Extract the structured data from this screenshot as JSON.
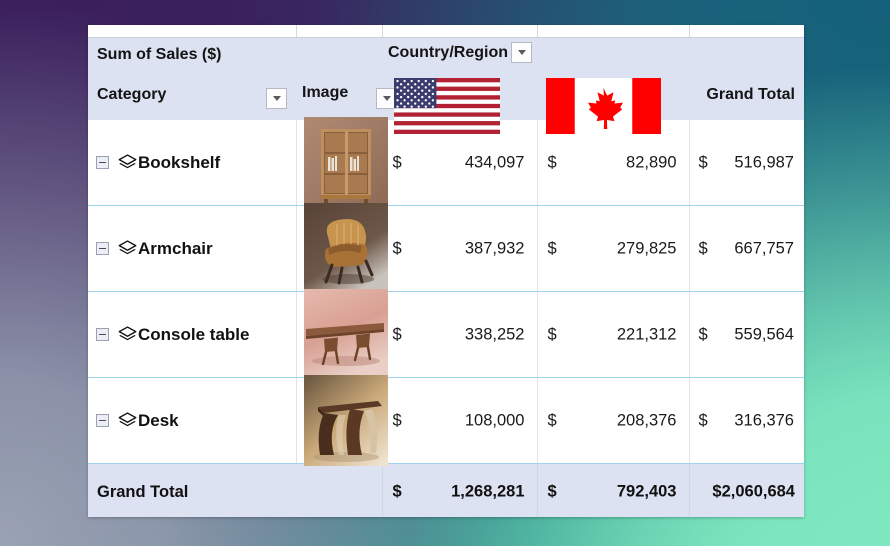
{
  "header": {
    "value_field_label": "Sum of Sales ($)",
    "column_field_label": "Country/Region",
    "row_field_label": "Category",
    "image_field_label": "Image",
    "grand_total_label": "Grand Total",
    "filters": [
      {
        "name": "category-filter",
        "label": "Category filter dropdown"
      },
      {
        "name": "image-filter",
        "label": "Image filter dropdown"
      },
      {
        "name": "country-filter",
        "label": "Country/Region filter dropdown"
      }
    ],
    "columns": [
      {
        "key": "us",
        "label": "United States",
        "icon": "flag-united-states"
      },
      {
        "key": "ca",
        "label": "Canada",
        "icon": "flag-canada"
      }
    ]
  },
  "rows": [
    {
      "category": "Bookshelf",
      "image_alt": "bookshelf-thumbnail",
      "us": {
        "currency": "$",
        "value": "434,097"
      },
      "ca": {
        "currency": "$",
        "value": "82,890"
      },
      "total": {
        "currency": "$",
        "value": "516,987"
      }
    },
    {
      "category": "Armchair",
      "image_alt": "armchair-thumbnail",
      "us": {
        "currency": "$",
        "value": "387,932"
      },
      "ca": {
        "currency": "$",
        "value": "279,825"
      },
      "total": {
        "currency": "$",
        "value": "667,757"
      }
    },
    {
      "category": "Console table",
      "image_alt": "console-table-thumbnail",
      "us": {
        "currency": "$",
        "value": "338,252"
      },
      "ca": {
        "currency": "$",
        "value": "221,312"
      },
      "total": {
        "currency": "$",
        "value": "559,564"
      }
    },
    {
      "category": "Desk",
      "image_alt": "desk-thumbnail",
      "us": {
        "currency": "$",
        "value": "108,000"
      },
      "ca": {
        "currency": "$",
        "value": "208,376"
      },
      "total": {
        "currency": "$",
        "value": "316,376"
      }
    }
  ],
  "grand_total": {
    "label": "Grand Total",
    "us": {
      "currency": "$",
      "value": "1,268,281"
    },
    "ca": {
      "currency": "$",
      "value": "792,403"
    },
    "total": {
      "currency": "",
      "value": "$2,060,684"
    }
  },
  "chart_data": {
    "type": "table",
    "title": "Sum of Sales ($)",
    "categories": [
      "Bookshelf",
      "Armchair",
      "Console table",
      "Desk"
    ],
    "series": [
      {
        "name": "United States",
        "values": [
          434097,
          387932,
          338252,
          108000
        ]
      },
      {
        "name": "Canada",
        "values": [
          82890,
          279825,
          221312,
          208376
        ]
      },
      {
        "name": "Grand Total",
        "values": [
          516987,
          667757,
          559564,
          316376
        ]
      }
    ],
    "column_totals": {
      "United States": 1268281,
      "Canada": 792403,
      "Grand Total": 2060684
    },
    "xlabel": "Category",
    "ylabel": "Sum of Sales ($)"
  },
  "theme": {
    "header_fill": "#dde2f2",
    "row_separator": "#9ed3ef",
    "text": "#141414",
    "card_background": "#ffffff"
  }
}
